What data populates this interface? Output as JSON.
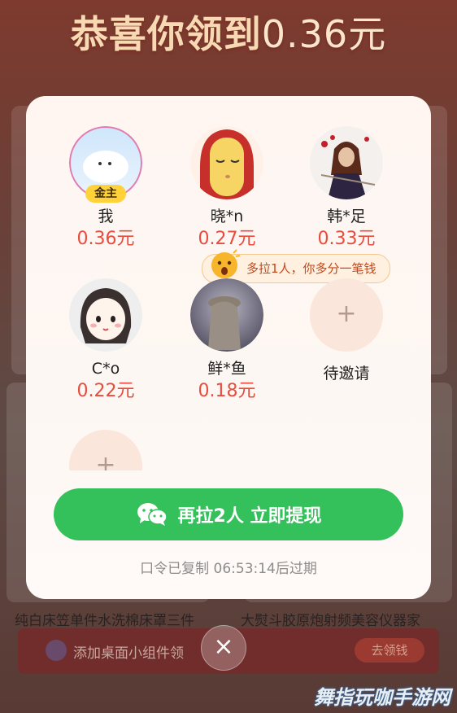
{
  "header": {
    "title_prefix": "恭喜你领到",
    "amount": "0.36元"
  },
  "members": [
    {
      "name": "我",
      "amount": "0.36元",
      "badge": "金主"
    },
    {
      "name": "晓*n",
      "amount": "0.27元"
    },
    {
      "name": "韩*足",
      "amount": "0.33元"
    },
    {
      "name": "C*o",
      "amount": "0.22元"
    },
    {
      "name": "鲜*鱼",
      "amount": "0.18元"
    }
  ],
  "pending": {
    "label": "待邀请",
    "plus": "+"
  },
  "tip": {
    "text": "多拉1人，你多分一笔钱"
  },
  "cta": {
    "label": "再拉2人 立即提现",
    "icon": "wechat-icon"
  },
  "copied_status": "口令已复制 06:53:14后过期",
  "close": {
    "symbol": "×"
  },
  "background": {
    "product_left": "纯白床笠单件水洗棉床罩三件",
    "product_right": "大熨斗胶原炮射频美容仪器家",
    "widget_text": "添加桌面小组件领",
    "widget_button": "去领钱"
  },
  "watermark": "舞指玩咖手游网",
  "colors": {
    "accent": "#34c05a",
    "amount": "#e94b3c",
    "badge": "#ffd23a"
  }
}
